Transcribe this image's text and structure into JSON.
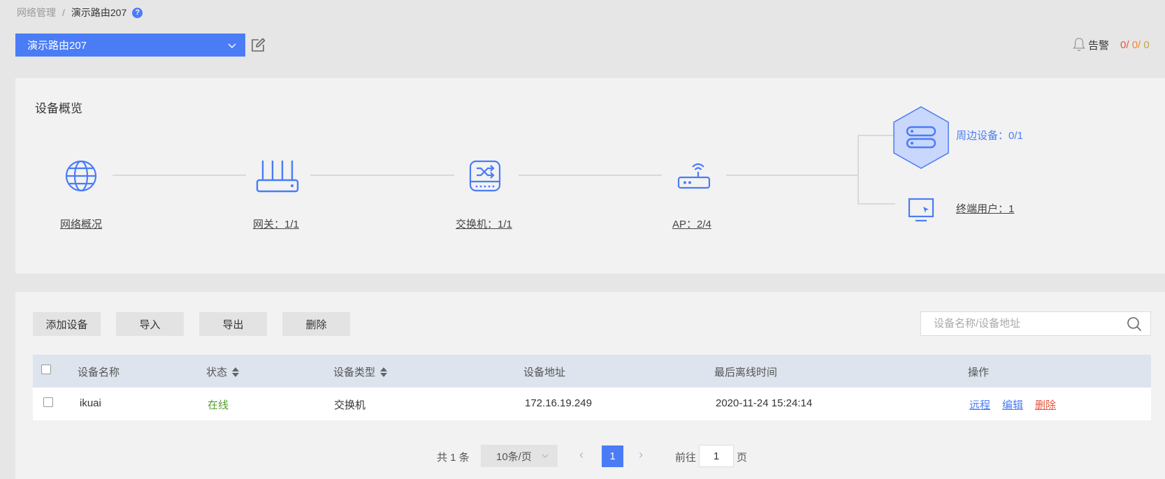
{
  "breadcrumb": {
    "parent": "网络管理",
    "separator": "/",
    "current": "演示路由207",
    "help": "?"
  },
  "router_select": {
    "value": "演示路由207"
  },
  "alarm": {
    "label": "告警",
    "critical": "0",
    "major": "0",
    "minor": "0",
    "sep": "/"
  },
  "overview": {
    "title": "设备概览",
    "network": {
      "label": "网络概况"
    },
    "gateway": {
      "label": "网关：1/1"
    },
    "switch": {
      "label": "交换机：1/1"
    },
    "ap": {
      "label": "AP：2/4"
    },
    "peripheral": {
      "label": "周边设备：0/1"
    },
    "terminal": {
      "label": "终端用户：1"
    }
  },
  "toolbar": {
    "add": "添加设备",
    "import": "导入",
    "export": "导出",
    "delete": "删除"
  },
  "search": {
    "placeholder": "设备名称/设备地址"
  },
  "table": {
    "columns": {
      "name": "设备名称",
      "status": "状态",
      "type": "设备类型",
      "address": "设备地址",
      "last_offline": "最后离线时间",
      "actions": "操作"
    },
    "rows": [
      {
        "name": "ikuai",
        "status": "在线",
        "type": "交换机",
        "address": "172.16.19.249",
        "last_offline": "2020-11-24 15:24:14",
        "remote": "远程",
        "edit": "编辑",
        "delete": "删除"
      }
    ]
  },
  "pagination": {
    "total": "共 1 条",
    "page_size": "10条/页",
    "current_page": "1",
    "goto_label": "前往",
    "goto_value": "1",
    "page_unit": "页"
  },
  "colors": {
    "accent": "#4a7cf6",
    "online": "#52a02c",
    "danger": "#e5553b",
    "alarm_major": "#f08a24",
    "alarm_minor": "#c4a53a"
  }
}
